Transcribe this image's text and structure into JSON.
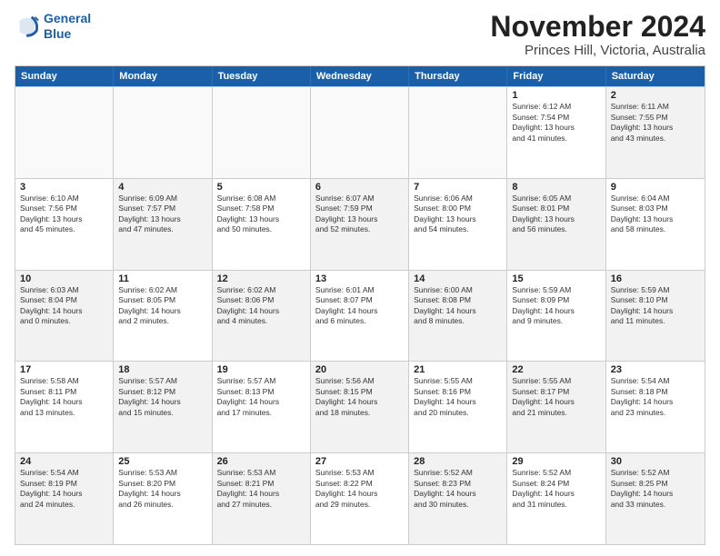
{
  "logo": {
    "line1": "General",
    "line2": "Blue"
  },
  "title": "November 2024",
  "subtitle": "Princes Hill, Victoria, Australia",
  "weekdays": [
    "Sunday",
    "Monday",
    "Tuesday",
    "Wednesday",
    "Thursday",
    "Friday",
    "Saturday"
  ],
  "weeks": [
    [
      {
        "day": "",
        "info": "",
        "empty": true
      },
      {
        "day": "",
        "info": "",
        "empty": true
      },
      {
        "day": "",
        "info": "",
        "empty": true
      },
      {
        "day": "",
        "info": "",
        "empty": true
      },
      {
        "day": "",
        "info": "",
        "empty": true
      },
      {
        "day": "1",
        "info": "Sunrise: 6:12 AM\nSunset: 7:54 PM\nDaylight: 13 hours\nand 41 minutes."
      },
      {
        "day": "2",
        "info": "Sunrise: 6:11 AM\nSunset: 7:55 PM\nDaylight: 13 hours\nand 43 minutes.",
        "shaded": true
      }
    ],
    [
      {
        "day": "3",
        "info": "Sunrise: 6:10 AM\nSunset: 7:56 PM\nDaylight: 13 hours\nand 45 minutes."
      },
      {
        "day": "4",
        "info": "Sunrise: 6:09 AM\nSunset: 7:57 PM\nDaylight: 13 hours\nand 47 minutes.",
        "shaded": true
      },
      {
        "day": "5",
        "info": "Sunrise: 6:08 AM\nSunset: 7:58 PM\nDaylight: 13 hours\nand 50 minutes."
      },
      {
        "day": "6",
        "info": "Sunrise: 6:07 AM\nSunset: 7:59 PM\nDaylight: 13 hours\nand 52 minutes.",
        "shaded": true
      },
      {
        "day": "7",
        "info": "Sunrise: 6:06 AM\nSunset: 8:00 PM\nDaylight: 13 hours\nand 54 minutes."
      },
      {
        "day": "8",
        "info": "Sunrise: 6:05 AM\nSunset: 8:01 PM\nDaylight: 13 hours\nand 56 minutes.",
        "shaded": true
      },
      {
        "day": "9",
        "info": "Sunrise: 6:04 AM\nSunset: 8:03 PM\nDaylight: 13 hours\nand 58 minutes."
      }
    ],
    [
      {
        "day": "10",
        "info": "Sunrise: 6:03 AM\nSunset: 8:04 PM\nDaylight: 14 hours\nand 0 minutes.",
        "shaded": true
      },
      {
        "day": "11",
        "info": "Sunrise: 6:02 AM\nSunset: 8:05 PM\nDaylight: 14 hours\nand 2 minutes."
      },
      {
        "day": "12",
        "info": "Sunrise: 6:02 AM\nSunset: 8:06 PM\nDaylight: 14 hours\nand 4 minutes.",
        "shaded": true
      },
      {
        "day": "13",
        "info": "Sunrise: 6:01 AM\nSunset: 8:07 PM\nDaylight: 14 hours\nand 6 minutes."
      },
      {
        "day": "14",
        "info": "Sunrise: 6:00 AM\nSunset: 8:08 PM\nDaylight: 14 hours\nand 8 minutes.",
        "shaded": true
      },
      {
        "day": "15",
        "info": "Sunrise: 5:59 AM\nSunset: 8:09 PM\nDaylight: 14 hours\nand 9 minutes."
      },
      {
        "day": "16",
        "info": "Sunrise: 5:59 AM\nSunset: 8:10 PM\nDaylight: 14 hours\nand 11 minutes.",
        "shaded": true
      }
    ],
    [
      {
        "day": "17",
        "info": "Sunrise: 5:58 AM\nSunset: 8:11 PM\nDaylight: 14 hours\nand 13 minutes."
      },
      {
        "day": "18",
        "info": "Sunrise: 5:57 AM\nSunset: 8:12 PM\nDaylight: 14 hours\nand 15 minutes.",
        "shaded": true
      },
      {
        "day": "19",
        "info": "Sunrise: 5:57 AM\nSunset: 8:13 PM\nDaylight: 14 hours\nand 17 minutes."
      },
      {
        "day": "20",
        "info": "Sunrise: 5:56 AM\nSunset: 8:15 PM\nDaylight: 14 hours\nand 18 minutes.",
        "shaded": true
      },
      {
        "day": "21",
        "info": "Sunrise: 5:55 AM\nSunset: 8:16 PM\nDaylight: 14 hours\nand 20 minutes."
      },
      {
        "day": "22",
        "info": "Sunrise: 5:55 AM\nSunset: 8:17 PM\nDaylight: 14 hours\nand 21 minutes.",
        "shaded": true
      },
      {
        "day": "23",
        "info": "Sunrise: 5:54 AM\nSunset: 8:18 PM\nDaylight: 14 hours\nand 23 minutes."
      }
    ],
    [
      {
        "day": "24",
        "info": "Sunrise: 5:54 AM\nSunset: 8:19 PM\nDaylight: 14 hours\nand 24 minutes.",
        "shaded": true
      },
      {
        "day": "25",
        "info": "Sunrise: 5:53 AM\nSunset: 8:20 PM\nDaylight: 14 hours\nand 26 minutes."
      },
      {
        "day": "26",
        "info": "Sunrise: 5:53 AM\nSunset: 8:21 PM\nDaylight: 14 hours\nand 27 minutes.",
        "shaded": true
      },
      {
        "day": "27",
        "info": "Sunrise: 5:53 AM\nSunset: 8:22 PM\nDaylight: 14 hours\nand 29 minutes."
      },
      {
        "day": "28",
        "info": "Sunrise: 5:52 AM\nSunset: 8:23 PM\nDaylight: 14 hours\nand 30 minutes.",
        "shaded": true
      },
      {
        "day": "29",
        "info": "Sunrise: 5:52 AM\nSunset: 8:24 PM\nDaylight: 14 hours\nand 31 minutes."
      },
      {
        "day": "30",
        "info": "Sunrise: 5:52 AM\nSunset: 8:25 PM\nDaylight: 14 hours\nand 33 minutes.",
        "shaded": true
      }
    ]
  ]
}
